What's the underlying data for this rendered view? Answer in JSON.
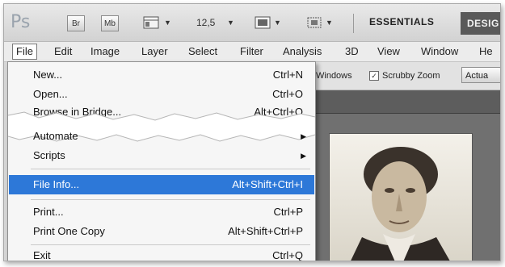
{
  "toolbar": {
    "logo": "Ps",
    "bridge_chip": "Br",
    "minibridge_chip": "Mb",
    "zoom": "12,5",
    "workspace_essentials": "ESSENTIALS",
    "workspace_design": "DESIG"
  },
  "menubar": {
    "items": [
      "File",
      "Edit",
      "Image",
      "Layer",
      "Select",
      "Filter",
      "Analysis",
      "3D",
      "View",
      "Window",
      "He"
    ]
  },
  "options": {
    "windows": "Windows",
    "scrubby_zoom": "Scrubby Zoom",
    "actual": "Actua"
  },
  "file_menu": {
    "items": [
      {
        "label": "New...",
        "shortcut": "Ctrl+N"
      },
      {
        "label": "Open...",
        "shortcut": "Ctrl+O"
      },
      {
        "label": "Browse in Bridge...",
        "shortcut": "Alt+Ctrl+O"
      },
      {
        "label": "Automate"
      },
      {
        "label": "Scripts"
      },
      {
        "label": "File Info...",
        "shortcut": "Alt+Shift+Ctrl+I"
      },
      {
        "label": "Print...",
        "shortcut": "Ctrl+P"
      },
      {
        "label": "Print One Copy",
        "shortcut": "Alt+Shift+Ctrl+P"
      },
      {
        "label": "Exit",
        "shortcut": "Ctrl+Q"
      }
    ]
  },
  "colors": {
    "highlight": "#2d78d8",
    "app_bar": "#d6d6d6",
    "canvas": "#707070"
  }
}
